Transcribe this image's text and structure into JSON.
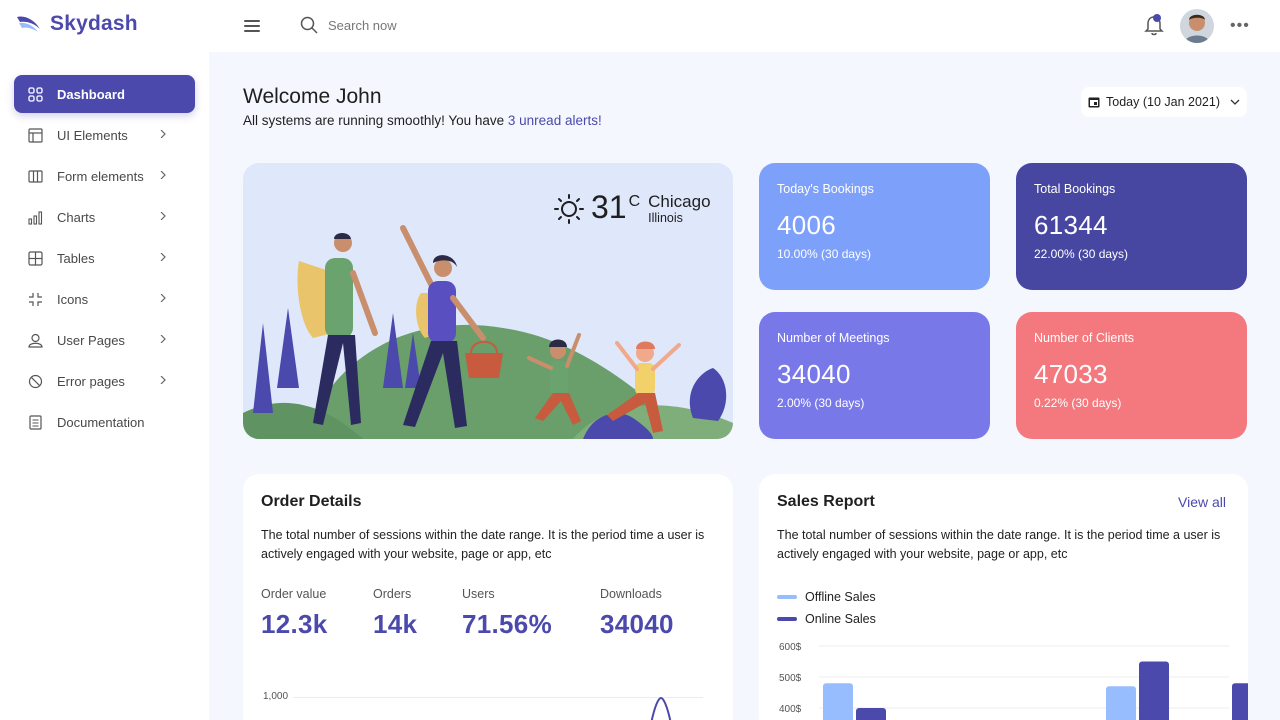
{
  "brand": {
    "name": "Skydash"
  },
  "search": {
    "placeholder": "Search now"
  },
  "sidebar": {
    "items": [
      {
        "label": "Dashboard",
        "icon": "grid-icon",
        "active": true
      },
      {
        "label": "UI Elements",
        "icon": "layout-icon"
      },
      {
        "label": "Form elements",
        "icon": "columns-icon"
      },
      {
        "label": "Charts",
        "icon": "bar-chart-icon"
      },
      {
        "label": "Tables",
        "icon": "table-icon"
      },
      {
        "label": "Icons",
        "icon": "expand-icon"
      },
      {
        "label": "User Pages",
        "icon": "user-icon"
      },
      {
        "label": "Error pages",
        "icon": "ban-icon"
      },
      {
        "label": "Documentation",
        "icon": "document-icon"
      }
    ]
  },
  "header": {
    "welcome": "Welcome John",
    "subtitle_prefix": "All systems are running smoothly! You have ",
    "subtitle_link": "3 unread alerts!",
    "date_label": "Today (10 Jan 2021)"
  },
  "weather": {
    "temp": "31",
    "unit": "C",
    "city": "Chicago",
    "state": "Illinois"
  },
  "stats": [
    {
      "title": "Today's Bookings",
      "value": "4006",
      "sub": "10.00% (30 days)",
      "color": "#7da0fa"
    },
    {
      "title": "Total Bookings",
      "value": "61344",
      "sub": "22.00% (30 days)",
      "color": "#4747a1"
    },
    {
      "title": "Number of Meetings",
      "value": "34040",
      "sub": "2.00% (30 days)",
      "color": "#7978e9"
    },
    {
      "title": "Number of Clients",
      "value": "47033",
      "sub": "0.22% (30 days)",
      "color": "#f3797e"
    }
  ],
  "order_details": {
    "title": "Order Details",
    "description": "The total number of sessions within the date range. It is the period time a user is actively engaged with your website, page or app, etc",
    "metrics": [
      {
        "label": "Order value",
        "value": "12.3k"
      },
      {
        "label": "Orders",
        "value": "14k"
      },
      {
        "label": "Users",
        "value": "71.56%"
      },
      {
        "label": "Downloads",
        "value": "34040"
      }
    ],
    "axis_label": "1,000"
  },
  "sales_report": {
    "title": "Sales Report",
    "view_all": "View all",
    "description": "The total number of sessions within the date range. It is the period time a user is actively engaged with your website, page or app, etc",
    "legend": [
      {
        "label": "Offline Sales",
        "color": "#98bdff"
      },
      {
        "label": "Online Sales",
        "color": "#4b49ac"
      }
    ]
  },
  "chart_data": {
    "type": "bar",
    "series": [
      {
        "name": "Offline Sales",
        "values": [
          480,
          null,
          470,
          null
        ]
      },
      {
        "name": "Online Sales",
        "values": [
          400,
          null,
          550,
          480
        ]
      }
    ],
    "categories": [
      "",
      "",
      "",
      ""
    ],
    "ylabels": [
      "600$",
      "500$",
      "400$"
    ],
    "ylim": [
      300,
      600
    ]
  },
  "colors": {
    "accent": "#4b49ac",
    "bg": "#f5f7ff"
  }
}
